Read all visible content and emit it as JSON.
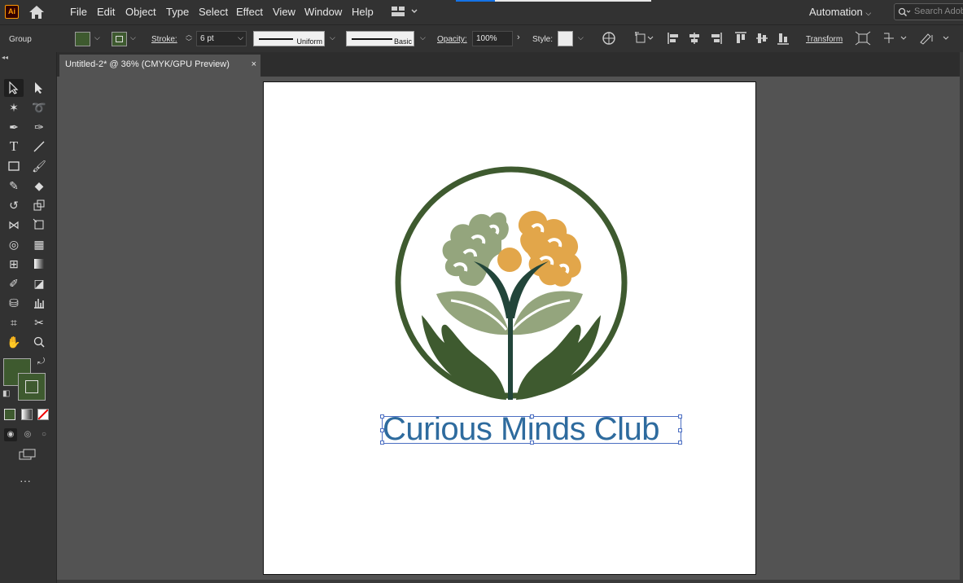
{
  "app": {
    "logo_text": "Ai"
  },
  "menu": {
    "items": [
      "File",
      "Edit",
      "Object",
      "Type",
      "Select",
      "Effect",
      "View",
      "Window",
      "Help"
    ],
    "workspace_label": "Automation",
    "search_placeholder": "Search Adobe Stock"
  },
  "control_bar": {
    "selection_type": "Group",
    "stroke_label": "Stroke:",
    "stroke_weight": "6 pt",
    "profile_label": "Uniform",
    "brush_label": "Basic",
    "opacity_label": "Opacity:",
    "opacity_value": "100%",
    "style_label": "Style:",
    "transform_label": "Transform",
    "fill_color": "#3e5a2f"
  },
  "document": {
    "tab_title": "Untitled-2* @ 36% (CMYK/GPU Preview)",
    "close_symbol": "×"
  },
  "artwork": {
    "headline": "Curious Minds Club",
    "colors": {
      "dark_green": "#3e5a2f",
      "sage": "#94a57d",
      "gold": "#e2a64a",
      "stem_green": "#22453a",
      "text_blue": "#2e6b9e"
    }
  },
  "tools": [
    "selection-tool",
    "direct-selection-tool",
    "magic-wand-tool",
    "lasso-tool",
    "pen-tool",
    "curvature-tool",
    "type-tool",
    "line-segment-tool",
    "rectangle-tool",
    "paintbrush-tool",
    "shaper-tool",
    "eraser-tool",
    "rotate-tool",
    "scale-tool",
    "width-tool",
    "free-transform-tool",
    "shape-builder-tool",
    "perspective-grid-tool",
    "mesh-tool",
    "gradient-tool",
    "eyedropper-tool",
    "blend-tool",
    "symbol-sprayer-tool",
    "column-graph-tool",
    "artboard-tool",
    "slice-tool",
    "hand-tool",
    "zoom-tool"
  ]
}
